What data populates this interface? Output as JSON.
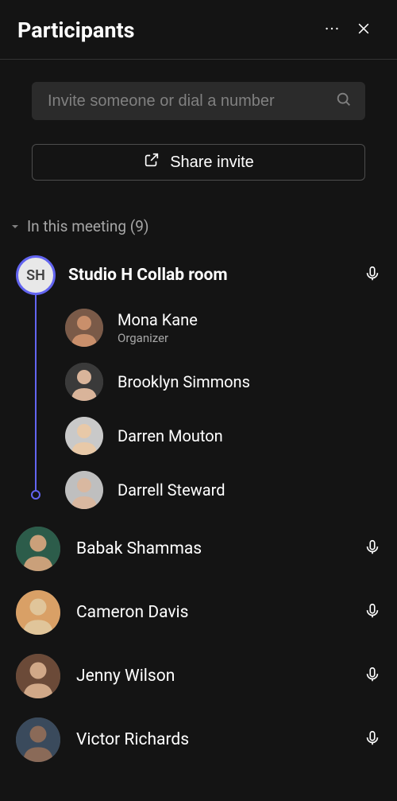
{
  "header": {
    "title": "Participants"
  },
  "search": {
    "placeholder": "Invite someone or dial a number"
  },
  "share": {
    "label": "Share invite"
  },
  "section": {
    "label": "In this meeting (9)",
    "count": 9
  },
  "room": {
    "initials": "SH",
    "name": "Studio H Collab room",
    "mic_on": true,
    "members": [
      {
        "name": "Mona Kane",
        "role": "Organizer",
        "avatar_colors": [
          "#7a5a48",
          "#c98f6b"
        ]
      },
      {
        "name": "Brooklyn Simmons",
        "role": "",
        "avatar_colors": [
          "#3a3a3a",
          "#d9b49a"
        ]
      },
      {
        "name": "Darren Mouton",
        "role": "",
        "avatar_colors": [
          "#c9c9c9",
          "#e8c9a8"
        ]
      },
      {
        "name": "Darrell Steward",
        "role": "",
        "avatar_colors": [
          "#bfbfbf",
          "#d9b8a0"
        ]
      }
    ]
  },
  "participants": [
    {
      "name": "Babak Shammas",
      "mic_on": true,
      "avatar_colors": [
        "#2c5c4a",
        "#caa07a"
      ]
    },
    {
      "name": "Cameron Davis",
      "mic_on": true,
      "avatar_colors": [
        "#d9a066",
        "#e0c59a"
      ]
    },
    {
      "name": "Jenny Wilson",
      "mic_on": true,
      "avatar_colors": [
        "#6b4a38",
        "#d0a888"
      ]
    },
    {
      "name": "Victor Richards",
      "mic_on": true,
      "avatar_colors": [
        "#3a4a5c",
        "#8a6a58"
      ]
    }
  ],
  "icons": {
    "more": "more-icon",
    "close": "close-icon",
    "search": "search-icon",
    "share": "share-icon",
    "mic": "mic-icon",
    "caret": "caret-down-icon"
  }
}
